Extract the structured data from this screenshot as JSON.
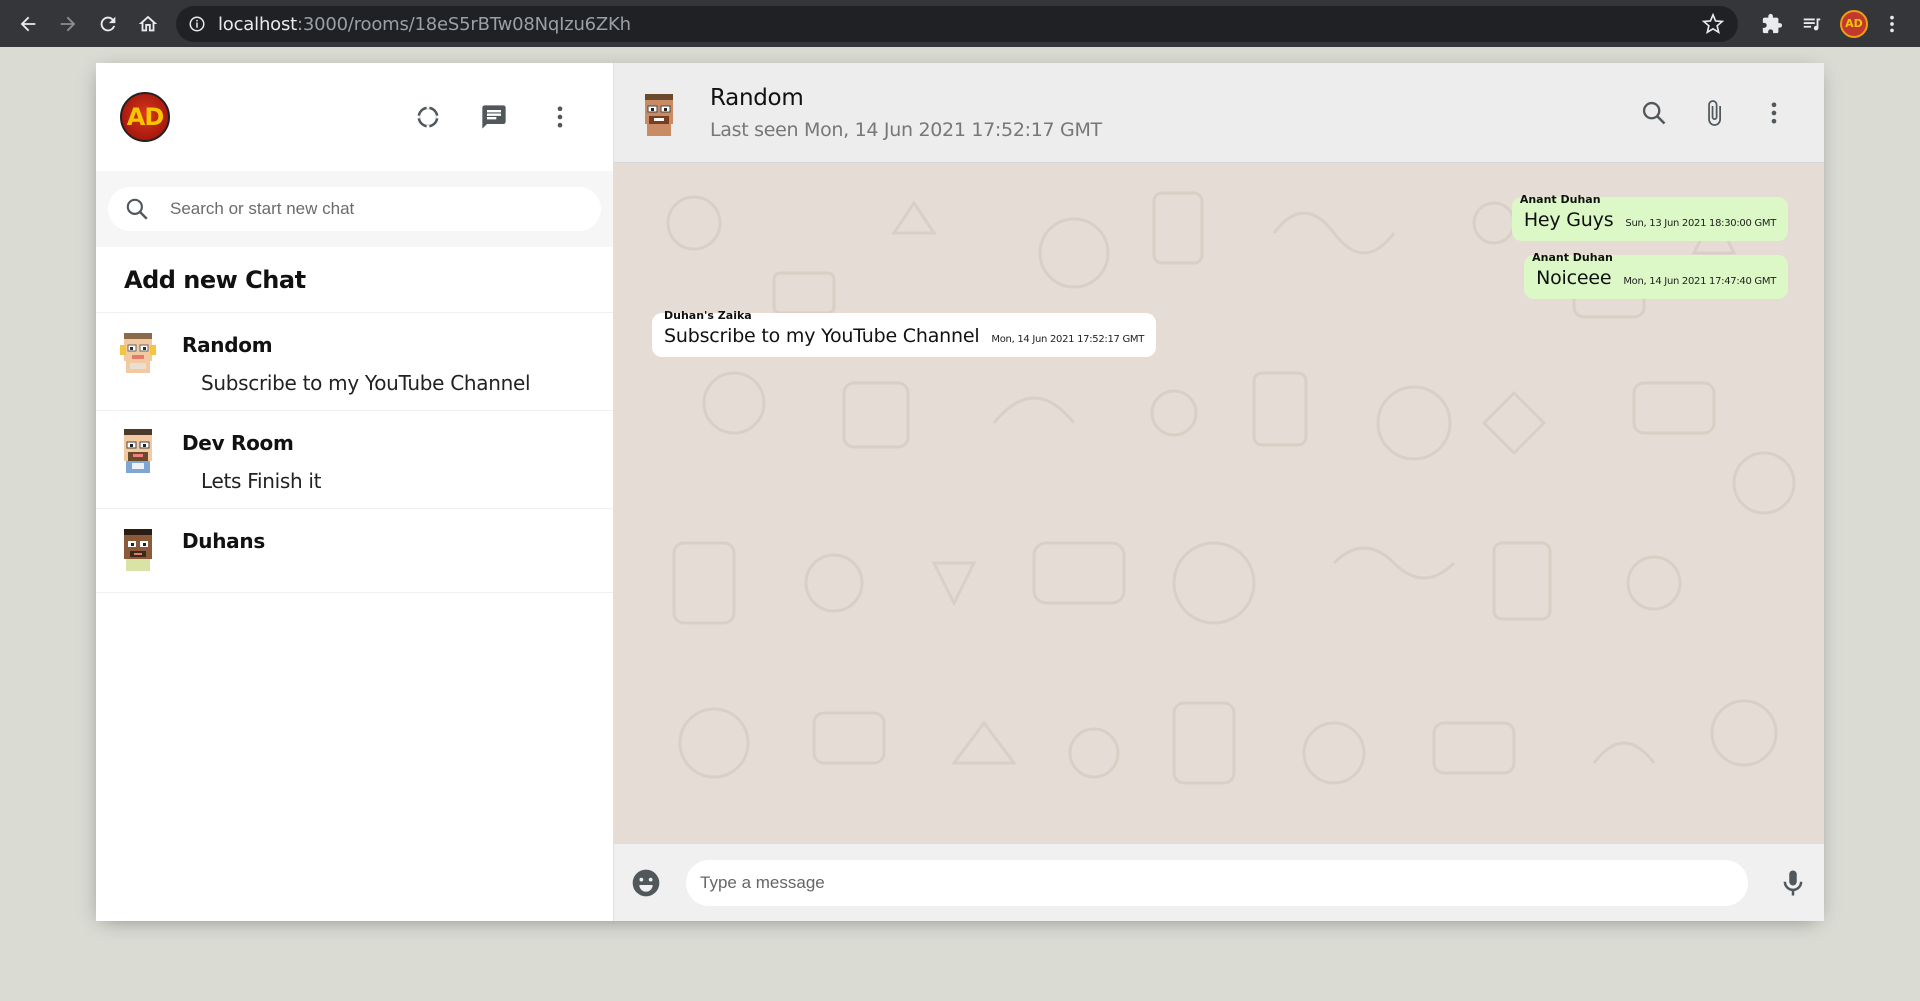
{
  "browser": {
    "url_host": "localhost",
    "url_rest": ":3000/rooms/18eS5rBTw08NqIzu6ZKh",
    "profile_initials": "AD"
  },
  "sidebar": {
    "brand_initials": "AD",
    "search_placeholder": "Search or start new chat",
    "add_new_chat": "Add new Chat",
    "chats": [
      {
        "name": "Random",
        "last_message": "Subscribe to my YouTube Channel"
      },
      {
        "name": "Dev Room",
        "last_message": "Lets Finish it"
      },
      {
        "name": "Duhans",
        "last_message": ""
      }
    ]
  },
  "chat": {
    "room_name": "Random",
    "last_seen": "Last seen Mon, 14 Jun 2021 17:52:17 GMT",
    "messages": [
      {
        "sender": "Anant Duhan",
        "text": "Hey Guys",
        "timestamp": "Sun, 13 Jun 2021 18:30:00 GMT",
        "is_own": true
      },
      {
        "sender": "Anant Duhan",
        "text": "Noiceee",
        "timestamp": "Mon, 14 Jun 2021 17:47:40 GMT",
        "is_own": true
      },
      {
        "sender": "Duhan's Zaika",
        "text": "Subscribe to my YouTube Channel",
        "timestamp": "Mon, 14 Jun 2021 17:52:17 GMT",
        "is_own": false
      }
    ],
    "input_placeholder": "Type a message"
  },
  "colors": {
    "own_bubble": "#dcf8c6",
    "other_bubble": "#ffffff",
    "chat_background": "#e5ddd5",
    "page_background": "#dadbd3"
  },
  "icons": {
    "browser": [
      "back-arrow-icon",
      "forward-arrow-icon",
      "reload-icon",
      "home-icon",
      "info-icon",
      "star-icon",
      "puzzle-icon",
      "reading-list-icon",
      "kebab-menu-icon"
    ],
    "sidebar": [
      "status-icon",
      "new-chat-icon",
      "more-vert-icon",
      "search-icon"
    ],
    "chat": [
      "search-icon",
      "attach-icon",
      "more-vert-icon",
      "emoji-icon",
      "mic-icon"
    ]
  }
}
